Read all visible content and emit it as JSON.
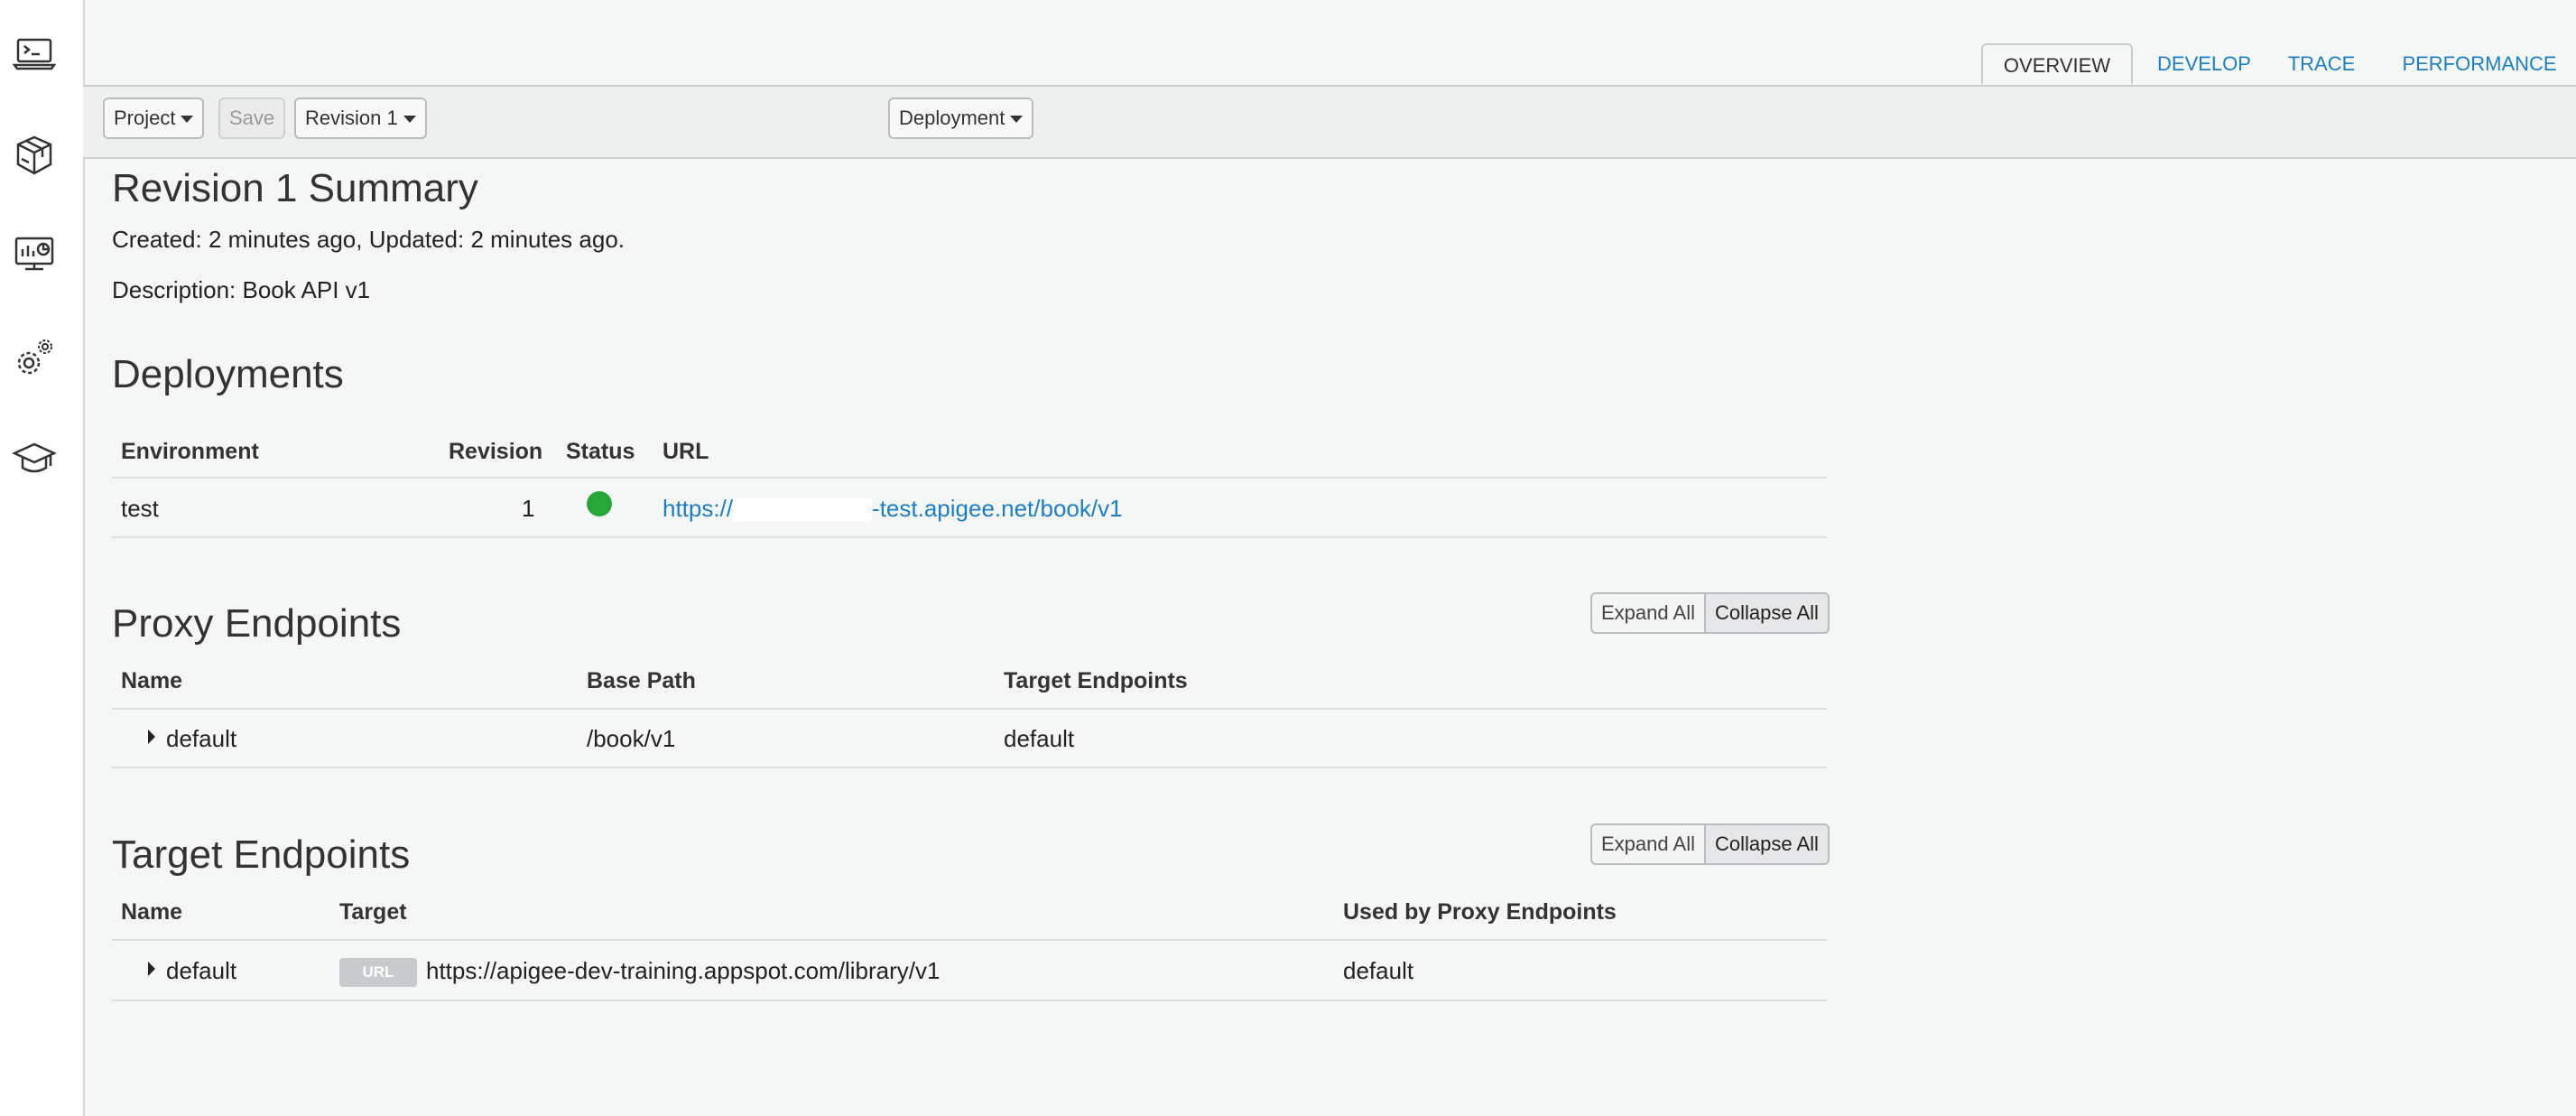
{
  "sidebar": {
    "icons": [
      "terminal-laptop-icon",
      "package-icon",
      "monitor-chart-icon",
      "gears-icon",
      "graduation-cap-icon"
    ]
  },
  "tabs": [
    {
      "label": "OVERVIEW",
      "active": true
    },
    {
      "label": "DEVELOP",
      "active": false
    },
    {
      "label": "TRACE",
      "active": false
    },
    {
      "label": "PERFORMANCE",
      "active": false
    }
  ],
  "toolbar": {
    "project_label": "Project",
    "save_label": "Save",
    "revision_label": "Revision 1",
    "deployment_label": "Deployment"
  },
  "summary": {
    "title": "Revision 1 Summary",
    "created_updated": "Created: 2 minutes ago, Updated: 2 minutes ago.",
    "description": "Description: Book API v1"
  },
  "deployments": {
    "title": "Deployments",
    "headers": {
      "environment": "Environment",
      "revision": "Revision",
      "status": "Status",
      "url": "URL"
    },
    "rows": [
      {
        "environment": "test",
        "revision": "1",
        "status_color": "#2aa53a",
        "url_prefix": "https://",
        "url_suffix": "-test.apigee.net/book/v1"
      }
    ]
  },
  "proxy_endpoints": {
    "title": "Proxy Endpoints",
    "expand_label": "Expand All",
    "collapse_label": "Collapse All",
    "headers": {
      "name": "Name",
      "base_path": "Base Path",
      "target_endpoints": "Target Endpoints"
    },
    "rows": [
      {
        "name": "default",
        "base_path": "/book/v1",
        "target_endpoints": "default"
      }
    ]
  },
  "target_endpoints": {
    "title": "Target Endpoints",
    "expand_label": "Expand All",
    "collapse_label": "Collapse All",
    "headers": {
      "name": "Name",
      "target": "Target",
      "used_by": "Used by Proxy Endpoints"
    },
    "rows": [
      {
        "name": "default",
        "badge": "URL",
        "target": "https://apigee-dev-training.appspot.com/library/v1",
        "used_by": "default"
      }
    ]
  },
  "colors": {
    "accent": "#1d7fc0",
    "status_ok": "#2aa53a"
  }
}
